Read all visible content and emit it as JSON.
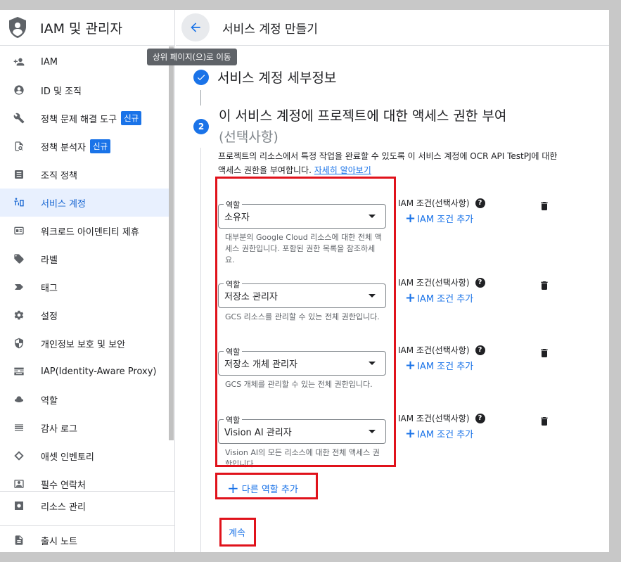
{
  "sidebar": {
    "title": "IAM 및 관리자",
    "items": [
      {
        "label": "IAM",
        "icon": "add-person-icon",
        "badge": null,
        "active": false
      },
      {
        "label": "ID 및 조직",
        "icon": "account-circle-icon",
        "badge": null,
        "active": false
      },
      {
        "label": "정책 문제 해결 도구",
        "icon": "wrench-icon",
        "badge": "신규",
        "active": false
      },
      {
        "label": "정책 분석자",
        "icon": "policy-analyzer-icon",
        "badge": "신규",
        "active": false
      },
      {
        "label": "조직 정책",
        "icon": "document-icon",
        "badge": null,
        "active": false
      },
      {
        "label": "서비스 계정",
        "icon": "service-account-icon",
        "badge": null,
        "active": true
      },
      {
        "label": "워크로드 아이덴티티 제휴",
        "icon": "id-card-icon",
        "badge": null,
        "active": false
      },
      {
        "label": "라벨",
        "icon": "tag-icon",
        "badge": null,
        "active": false
      },
      {
        "label": "태그",
        "icon": "label-arrow-icon",
        "badge": null,
        "active": false
      },
      {
        "label": "설정",
        "icon": "gear-icon",
        "badge": null,
        "active": false
      },
      {
        "label": "개인정보 보호 및 보안",
        "icon": "shield-icon",
        "badge": null,
        "active": false
      },
      {
        "label": "IAP(Identity-Aware Proxy)",
        "icon": "iap-icon",
        "badge": null,
        "active": false
      },
      {
        "label": "역할",
        "icon": "hat-icon",
        "badge": null,
        "active": false
      },
      {
        "label": "감사 로그",
        "icon": "list-icon",
        "badge": null,
        "active": false
      },
      {
        "label": "애셋 인벤토리",
        "icon": "diamond-icon",
        "badge": null,
        "active": false
      },
      {
        "label": "필수 연락처",
        "icon": "contact-icon",
        "badge": null,
        "active": false
      }
    ],
    "footer": [
      {
        "label": "리소스 관리",
        "icon": "resource-gear-icon"
      },
      {
        "label": "출시 노트",
        "icon": "release-notes-icon"
      }
    ]
  },
  "header": {
    "title": "서비스 계정 만들기",
    "back_tooltip": "상위 페이지(으)로 이동"
  },
  "step1": {
    "title": "서비스 계정 세부정보"
  },
  "step2": {
    "number": "2",
    "title": "이 서비스 계정에 프로젝트에 대한 액세스 권한 부여",
    "title_optional": "(선택사항)",
    "description": "프로젝트의 리소스에서 특정 작업을 완료할 수 있도록 이 서비스 계정에 OCR API TestPJ에 대한 액세스 권한을 부여합니다.",
    "learn_more": "자세히 알아보기"
  },
  "roles": [
    {
      "label": "역할",
      "value": "소유자",
      "help": "대부분의 Google Cloud 리소스에 대한 전체 액세스 권한입니다. 포함된 권한 목록을 참조하세요.",
      "condition_label": "IAM 조건(선택사항)",
      "add_condition": "IAM 조건 추가"
    },
    {
      "label": "역할",
      "value": "저장소 관리자",
      "help": "GCS 리소스를 관리할 수 있는 전체 권한입니다.",
      "condition_label": "IAM 조건(선택사항)",
      "add_condition": "IAM 조건 추가"
    },
    {
      "label": "역할",
      "value": "저장소 개체 관리자",
      "help": "GCS 개체를 관리할 수 있는 전체 권한입니다.",
      "condition_label": "IAM 조건(선택사항)",
      "add_condition": "IAM 조건 추가"
    },
    {
      "label": "역할",
      "value": "Vision AI 관리자",
      "help": "Vision AI의 모든 리소스에 대한 전체 액세스 권한입니다.",
      "condition_label": "IAM 조건(선택사항)",
      "add_condition": "IAM 조건 추가"
    }
  ],
  "add_role": "다른 역할 추가",
  "continue": "계속",
  "colors": {
    "accent": "#1a73e8",
    "highlight_border": "#e0121b",
    "active_bg": "#e8f0fe"
  }
}
